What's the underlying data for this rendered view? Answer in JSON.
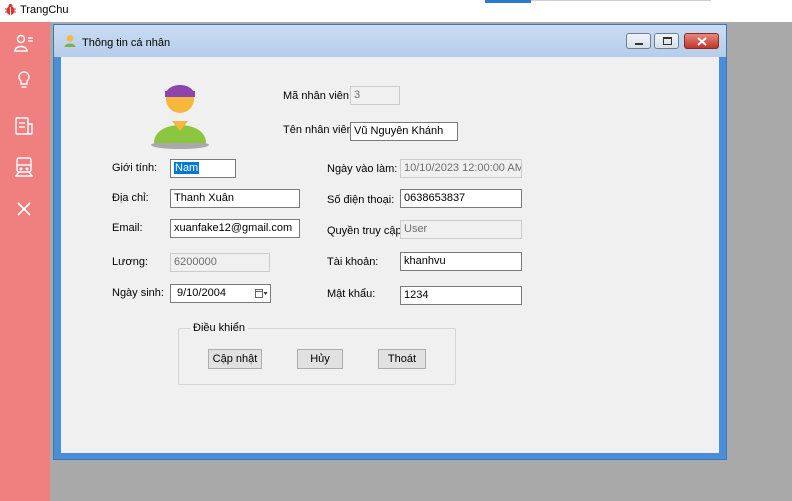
{
  "app": {
    "title": "TrangChu"
  },
  "sidebar": {
    "items": [
      {
        "icon": "users-icon"
      },
      {
        "icon": "idea-icon"
      },
      {
        "icon": "receipt-icon"
      },
      {
        "icon": "train-icon"
      },
      {
        "icon": "close-icon"
      }
    ]
  },
  "window": {
    "title": "Thông tin cá nhân",
    "controls": [
      "minimize",
      "maximize",
      "close"
    ]
  },
  "form": {
    "employee_id": {
      "label": "Mã nhân viên:",
      "value": "3"
    },
    "employee_name": {
      "label": "Tên nhân viên:",
      "value": "Vũ Nguyên Khánh"
    },
    "gender": {
      "label": "Giới tính:",
      "value": "Nam"
    },
    "start_date": {
      "label": "Ngày vào làm:",
      "value": "10/10/2023 12:00:00 AM"
    },
    "address": {
      "label": "Địa chỉ:",
      "value": "Thanh Xuân"
    },
    "phone": {
      "label": "Số điện thoại:",
      "value": "0638653837"
    },
    "email": {
      "label": "Email:",
      "value": "xuanfake12@gmail.com"
    },
    "access_right": {
      "label": "Quyền truy cập:",
      "value": "User"
    },
    "salary": {
      "label": "Lương:",
      "value": "6200000"
    },
    "account": {
      "label": "Tài khoản:",
      "value": "khanhvu"
    },
    "birth_date": {
      "label": "Ngày sinh:",
      "value": "9/10/2004"
    },
    "password": {
      "label": "Mật khẩu:",
      "value": "1234"
    }
  },
  "controls_group": {
    "caption": "Điều khiển",
    "update_label": "Cập nhật",
    "cancel_label": "Hủy",
    "exit_label": "Thoát"
  },
  "colors": {
    "sidebar": "#f07f80",
    "workarea": "#a9a9a9",
    "window_border": "#4a8ed8",
    "client": "#f0f0f0",
    "selection": "#0078d7"
  }
}
